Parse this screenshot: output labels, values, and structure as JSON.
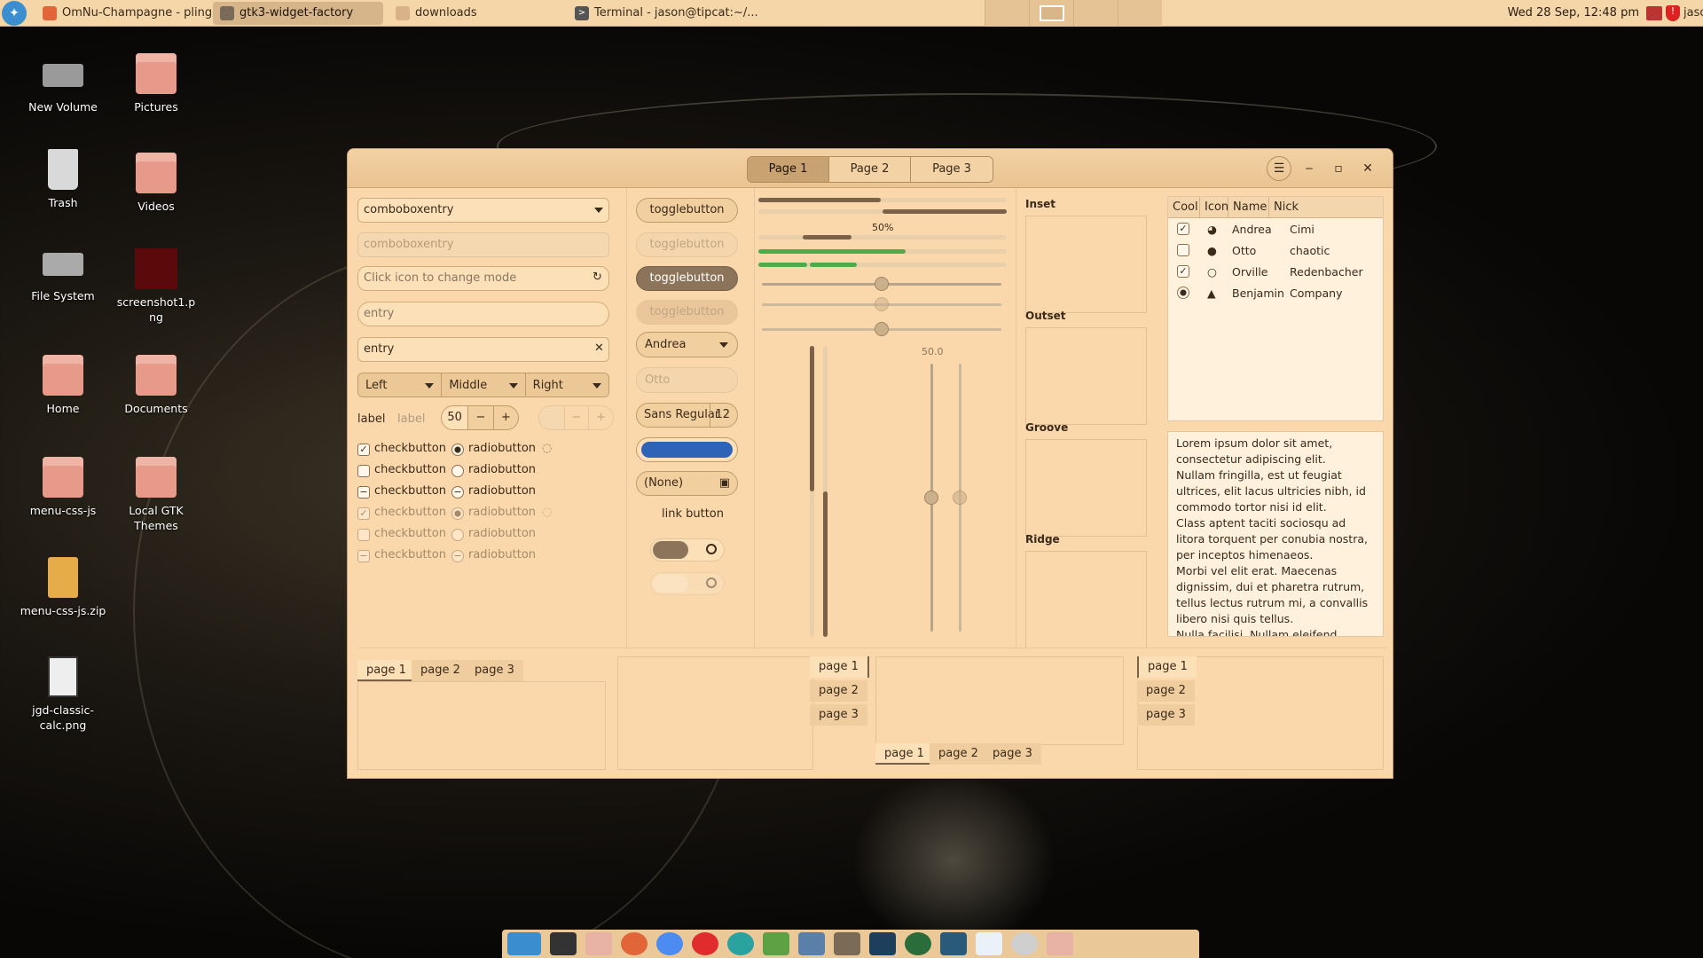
{
  "topbar": {
    "tasks": [
      {
        "label": "OmNu-Champagne - pling....",
        "icon": "firefox-icon"
      },
      {
        "label": "gtk3-widget-factory",
        "icon": "window-icon"
      },
      {
        "label": "downloads",
        "icon": "folder-icon"
      },
      {
        "label": "Terminal - jason@tipcat:~/...",
        "icon": "terminal-icon"
      }
    ],
    "clock": "Wed 28 Sep, 12:48 pm",
    "user": "jason"
  },
  "desktop": [
    {
      "label": "New Volume",
      "icon": "drive-icon"
    },
    {
      "label": "Pictures",
      "icon": "folder-icon"
    },
    {
      "label": "Trash",
      "icon": "trash-icon"
    },
    {
      "label": "Videos",
      "icon": "folder-icon"
    },
    {
      "label": "File System",
      "icon": "drive-icon"
    },
    {
      "label": "screenshot1.png",
      "icon": "image-icon"
    },
    {
      "label": "Home",
      "icon": "home-folder-icon"
    },
    {
      "label": "Documents",
      "icon": "folder-icon"
    },
    {
      "label": "menu-css-js",
      "icon": "folder-icon"
    },
    {
      "label": "Local GTK Themes",
      "icon": "folder-icon"
    },
    {
      "label": "menu-css-js.zip",
      "icon": "archive-icon"
    },
    {
      "label": "jgd-classic-calc.png",
      "icon": "calculator-icon"
    }
  ],
  "window": {
    "stack_tabs": [
      "Page 1",
      "Page 2",
      "Page 3"
    ],
    "selected_tab": 0,
    "combo1": "comboboxentry",
    "combo2": "comboboxentry",
    "mode_placeholder": "Click icon to change mode",
    "entry_placeholder": "entry",
    "entry_value": "entry",
    "segments": [
      "Left",
      "Middle",
      "Right"
    ],
    "label1": "label",
    "label2": "label",
    "spin_value": "50",
    "checks": [
      {
        "label": "checkbutton",
        "state": "checked"
      },
      {
        "label": "checkbutton",
        "state": "unchecked"
      },
      {
        "label": "checkbutton",
        "state": "mixed"
      },
      {
        "label": "checkbutton",
        "state": "checked",
        "disabled": true
      },
      {
        "label": "checkbutton",
        "state": "unchecked",
        "disabled": true
      },
      {
        "label": "checkbutton",
        "state": "mixed",
        "disabled": true
      }
    ],
    "radios": [
      {
        "label": "radiobutton",
        "state": "checked"
      },
      {
        "label": "radiobutton",
        "state": "unchecked"
      },
      {
        "label": "radiobutton",
        "state": "mixed"
      },
      {
        "label": "radiobutton",
        "state": "checked",
        "disabled": true
      },
      {
        "label": "radiobutton",
        "state": "unchecked",
        "disabled": true
      },
      {
        "label": "radiobutton",
        "state": "mixed",
        "disabled": true
      }
    ],
    "toggles": [
      "togglebutton",
      "togglebutton",
      "togglebutton",
      "togglebutton"
    ],
    "combo_andrea": "Andrea",
    "combo_otto": "Otto",
    "font": "Sans Regular",
    "font_size": "12",
    "file": "(None)",
    "link": "link button",
    "progress_label": "50%",
    "scale_label": "50.0",
    "progress": {
      "top": 0.5,
      "level": 0.57
    },
    "frames": [
      "Inset",
      "Outset",
      "Groove",
      "Ridge"
    ],
    "tree_headers": [
      "Cool",
      "Icon",
      "Name",
      "Nick"
    ],
    "tree_rows": [
      {
        "cool": "checked",
        "icon": "face-icon",
        "name": "Andrea",
        "nick": "Cimi"
      },
      {
        "cool": "unchecked",
        "icon": "warning-icon",
        "name": "Otto",
        "nick": "chaotic"
      },
      {
        "cool": "checked",
        "icon": "circle-icon",
        "name": "Orville",
        "nick": "Redenbacher"
      },
      {
        "cool": "radio",
        "icon": "hat-icon",
        "name": "Benjamin",
        "nick": "Company"
      }
    ],
    "lorem": [
      "Lorem ipsum dolor sit amet, consectetur adipiscing elit.",
      "Nullam fringilla, est ut feugiat ultrices, elit lacus ultricies nibh, id commodo tortor nisi id elit.",
      "Class aptent taciti sociosqu ad litora torquent per conubia nostra, per inceptos himenaeos.",
      "Morbi vel elit erat. Maecenas dignissim, dui et pharetra rutrum, tellus lectus rutrum mi, a convallis libero nisi quis tellus.",
      "Nulla facilisi. Nullam eleifend lobortis"
    ],
    "nb_tabs": [
      "page 1",
      "page 2",
      "page 3"
    ]
  },
  "colors": {
    "accent": "#2f63b8",
    "panel": "#fad8ab"
  }
}
